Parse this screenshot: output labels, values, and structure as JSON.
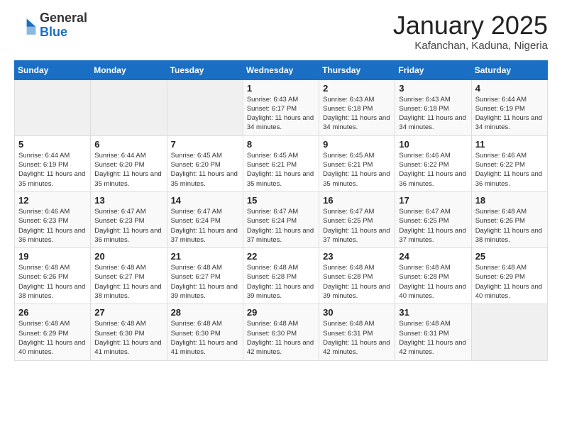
{
  "header": {
    "logo_general": "General",
    "logo_blue": "Blue",
    "month_title": "January 2025",
    "subtitle": "Kafanchan, Kaduna, Nigeria"
  },
  "days_of_week": [
    "Sunday",
    "Monday",
    "Tuesday",
    "Wednesday",
    "Thursday",
    "Friday",
    "Saturday"
  ],
  "weeks": [
    [
      {
        "day": "",
        "info": ""
      },
      {
        "day": "",
        "info": ""
      },
      {
        "day": "",
        "info": ""
      },
      {
        "day": "1",
        "info": "Sunrise: 6:43 AM\nSunset: 6:17 PM\nDaylight: 11 hours\nand 34 minutes."
      },
      {
        "day": "2",
        "info": "Sunrise: 6:43 AM\nSunset: 6:18 PM\nDaylight: 11 hours\nand 34 minutes."
      },
      {
        "day": "3",
        "info": "Sunrise: 6:43 AM\nSunset: 6:18 PM\nDaylight: 11 hours\nand 34 minutes."
      },
      {
        "day": "4",
        "info": "Sunrise: 6:44 AM\nSunset: 6:19 PM\nDaylight: 11 hours\nand 34 minutes."
      }
    ],
    [
      {
        "day": "5",
        "info": "Sunrise: 6:44 AM\nSunset: 6:19 PM\nDaylight: 11 hours\nand 35 minutes."
      },
      {
        "day": "6",
        "info": "Sunrise: 6:44 AM\nSunset: 6:20 PM\nDaylight: 11 hours\nand 35 minutes."
      },
      {
        "day": "7",
        "info": "Sunrise: 6:45 AM\nSunset: 6:20 PM\nDaylight: 11 hours\nand 35 minutes."
      },
      {
        "day": "8",
        "info": "Sunrise: 6:45 AM\nSunset: 6:21 PM\nDaylight: 11 hours\nand 35 minutes."
      },
      {
        "day": "9",
        "info": "Sunrise: 6:45 AM\nSunset: 6:21 PM\nDaylight: 11 hours\nand 35 minutes."
      },
      {
        "day": "10",
        "info": "Sunrise: 6:46 AM\nSunset: 6:22 PM\nDaylight: 11 hours\nand 36 minutes."
      },
      {
        "day": "11",
        "info": "Sunrise: 6:46 AM\nSunset: 6:22 PM\nDaylight: 11 hours\nand 36 minutes."
      }
    ],
    [
      {
        "day": "12",
        "info": "Sunrise: 6:46 AM\nSunset: 6:23 PM\nDaylight: 11 hours\nand 36 minutes."
      },
      {
        "day": "13",
        "info": "Sunrise: 6:47 AM\nSunset: 6:23 PM\nDaylight: 11 hours\nand 36 minutes."
      },
      {
        "day": "14",
        "info": "Sunrise: 6:47 AM\nSunset: 6:24 PM\nDaylight: 11 hours\nand 37 minutes."
      },
      {
        "day": "15",
        "info": "Sunrise: 6:47 AM\nSunset: 6:24 PM\nDaylight: 11 hours\nand 37 minutes."
      },
      {
        "day": "16",
        "info": "Sunrise: 6:47 AM\nSunset: 6:25 PM\nDaylight: 11 hours\nand 37 minutes."
      },
      {
        "day": "17",
        "info": "Sunrise: 6:47 AM\nSunset: 6:25 PM\nDaylight: 11 hours\nand 37 minutes."
      },
      {
        "day": "18",
        "info": "Sunrise: 6:48 AM\nSunset: 6:26 PM\nDaylight: 11 hours\nand 38 minutes."
      }
    ],
    [
      {
        "day": "19",
        "info": "Sunrise: 6:48 AM\nSunset: 6:26 PM\nDaylight: 11 hours\nand 38 minutes."
      },
      {
        "day": "20",
        "info": "Sunrise: 6:48 AM\nSunset: 6:27 PM\nDaylight: 11 hours\nand 38 minutes."
      },
      {
        "day": "21",
        "info": "Sunrise: 6:48 AM\nSunset: 6:27 PM\nDaylight: 11 hours\nand 39 minutes."
      },
      {
        "day": "22",
        "info": "Sunrise: 6:48 AM\nSunset: 6:28 PM\nDaylight: 11 hours\nand 39 minutes."
      },
      {
        "day": "23",
        "info": "Sunrise: 6:48 AM\nSunset: 6:28 PM\nDaylight: 11 hours\nand 39 minutes."
      },
      {
        "day": "24",
        "info": "Sunrise: 6:48 AM\nSunset: 6:28 PM\nDaylight: 11 hours\nand 40 minutes."
      },
      {
        "day": "25",
        "info": "Sunrise: 6:48 AM\nSunset: 6:29 PM\nDaylight: 11 hours\nand 40 minutes."
      }
    ],
    [
      {
        "day": "26",
        "info": "Sunrise: 6:48 AM\nSunset: 6:29 PM\nDaylight: 11 hours\nand 40 minutes."
      },
      {
        "day": "27",
        "info": "Sunrise: 6:48 AM\nSunset: 6:30 PM\nDaylight: 11 hours\nand 41 minutes."
      },
      {
        "day": "28",
        "info": "Sunrise: 6:48 AM\nSunset: 6:30 PM\nDaylight: 11 hours\nand 41 minutes."
      },
      {
        "day": "29",
        "info": "Sunrise: 6:48 AM\nSunset: 6:30 PM\nDaylight: 11 hours\nand 42 minutes."
      },
      {
        "day": "30",
        "info": "Sunrise: 6:48 AM\nSunset: 6:31 PM\nDaylight: 11 hours\nand 42 minutes."
      },
      {
        "day": "31",
        "info": "Sunrise: 6:48 AM\nSunset: 6:31 PM\nDaylight: 11 hours\nand 42 minutes."
      },
      {
        "day": "",
        "info": ""
      }
    ]
  ]
}
